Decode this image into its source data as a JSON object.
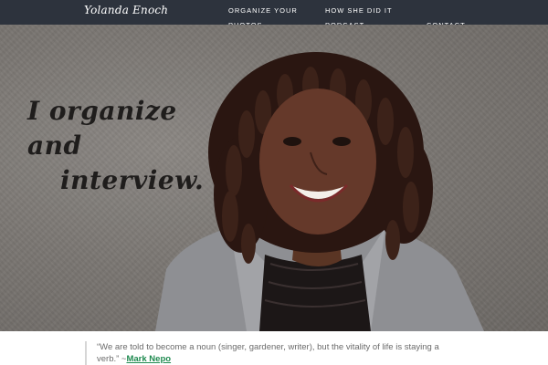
{
  "nav": {
    "logo": "Yolanda Enoch",
    "links": [
      {
        "label": "ORGANIZE YOUR PHOTOS"
      },
      {
        "label": "HOW SHE DID IT PODCAST"
      },
      {
        "label": "CONTACT"
      }
    ],
    "background": "#2d333d"
  },
  "hero": {
    "tagline_line1": "I organize and",
    "tagline_line2": "interview."
  },
  "quote": {
    "text": "“We are told to become a noun (singer, gardener, writer), but the vitality of life is staying a verb.” ~",
    "author": "Mark Nepo",
    "author_color": "#1e8a4f"
  }
}
